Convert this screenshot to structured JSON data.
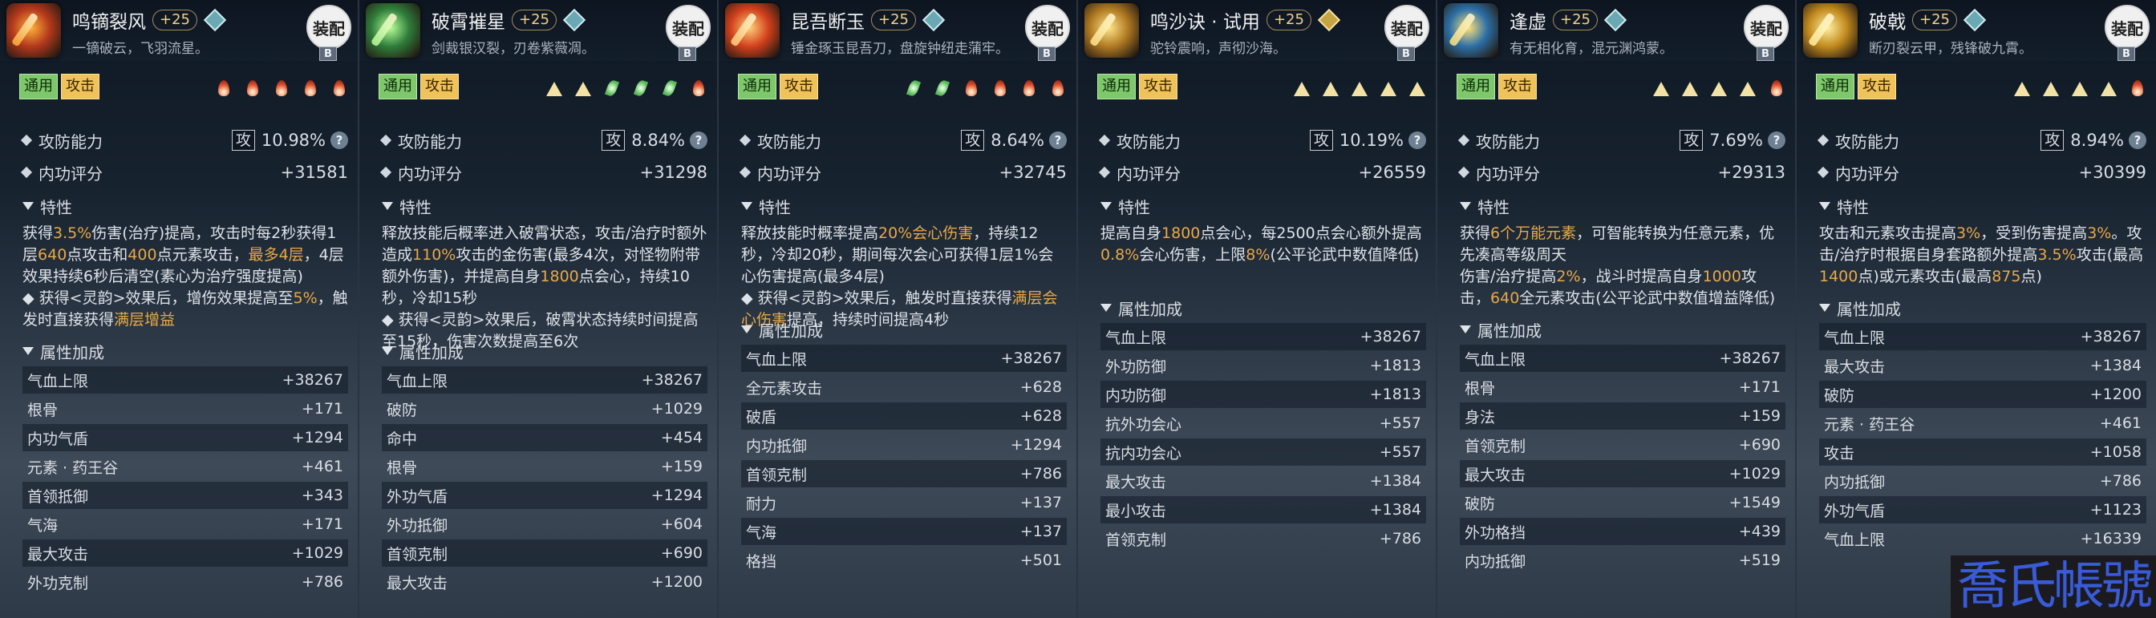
{
  "watermark": "喬氏帳號",
  "common": {
    "equip_label": "装配",
    "badge": "B",
    "tag_general": "通用",
    "tag_attack": "攻击",
    "ability_label": "攻防能力",
    "ability_box": "攻",
    "score_label": "内功评分",
    "traits_label": "特性",
    "attrs_label": "属性加成",
    "help_icon": "?"
  },
  "cards": [
    {
      "name": "鸣镝裂风",
      "level": "+25",
      "gem": "teal",
      "subtitle": "一镝破云，飞羽流星。",
      "icon": "flame-arrow-icon",
      "colors": [
        "#ffb13a",
        "#b3381c"
      ],
      "slots": [
        "fire",
        "fire",
        "fire",
        "fire",
        "fire"
      ],
      "ability": "10.98%",
      "score": "+31581",
      "desc": [
        [
          "获得",
          ""
        ],
        [
          "3.5%",
          "h"
        ],
        [
          "伤害(治疗)提高，攻击时每2秒获得1层",
          ""
        ],
        [
          "640",
          "h"
        ],
        [
          "点攻击和",
          ""
        ],
        [
          "400",
          "h"
        ],
        [
          "点元素攻击，",
          ""
        ],
        [
          "最多4层",
          "h"
        ],
        [
          "，4层效果持续6秒后清空(素心为治疗强度提高)",
          ""
        ],
        [
          "\n◆ 获得<灵韵>效果后，增伤效果提高至",
          ""
        ],
        [
          "5%",
          "h"
        ],
        [
          "，触发时直接获得",
          ""
        ],
        [
          "满层增益",
          "h"
        ]
      ],
      "attrs": [
        [
          "气血上限",
          "+38267"
        ],
        [
          "根骨",
          "+171"
        ],
        [
          "内功气盾",
          "+1294"
        ],
        [
          "元素 · 药王谷",
          "+461"
        ],
        [
          "首领抵御",
          "+343"
        ],
        [
          "气海",
          "+171"
        ],
        [
          "最大攻击",
          "+1029"
        ],
        [
          "外功克制",
          "+786"
        ]
      ]
    },
    {
      "name": "破霄摧星",
      "level": "+25",
      "gem": "teal",
      "subtitle": "剑裁银汉裂，刃卷紫薇凋。",
      "icon": "green-blade-icon",
      "colors": [
        "#b8ff9a",
        "#2f7d3a"
      ],
      "slots": [
        "tri",
        "tri",
        "leaf",
        "leaf",
        "leaf",
        "fire"
      ],
      "ability": "8.84%",
      "score": "+31298",
      "desc": [
        [
          "释放技能后概率进入破霄状态，攻击/治疗时额外造成",
          ""
        ],
        [
          "110%",
          "h"
        ],
        [
          "攻击的金伤害(最多4次，对怪物附带额外伤害)，并提高自身",
          ""
        ],
        [
          "1800",
          "h"
        ],
        [
          "点会心，持续10秒，冷却15秒",
          ""
        ],
        [
          "\n◆ 获得<灵韵>效果后，破霄状态持续时间提高至15秒，伤害次数提高至6次",
          ""
        ]
      ],
      "attrs": [
        [
          "气血上限",
          "+38267"
        ],
        [
          "破防",
          "+1029"
        ],
        [
          "命中",
          "+454"
        ],
        [
          "根骨",
          "+159"
        ],
        [
          "外功气盾",
          "+1294"
        ],
        [
          "外功抵御",
          "+604"
        ],
        [
          "首领克制",
          "+690"
        ],
        [
          "最大攻击",
          "+1200"
        ]
      ]
    },
    {
      "name": "昆吾断玉",
      "level": "+25",
      "gem": "teal",
      "subtitle": "锤金琢玉昆吾刀，盘旋钟纽走蒲牢。",
      "icon": "fire-blade-icon",
      "colors": [
        "#ffd07a",
        "#d2401c"
      ],
      "slots": [
        "leaf",
        "leaf",
        "fire",
        "fire",
        "fire",
        "fire"
      ],
      "ability": "8.64%",
      "score": "+32745",
      "desc": [
        [
          "释放技能时概率提高",
          ""
        ],
        [
          "20%会心伤害",
          "h"
        ],
        [
          "，持续12秒，冷却20秒，期间每次会心可获得1层1%会心伤害提高(最多4层)",
          ""
        ],
        [
          "\n◆ 获得<灵韵>效果后，触发时直接获得",
          ""
        ],
        [
          "满层会心伤害",
          "h"
        ],
        [
          "提高，持续时间提高4秒",
          ""
        ]
      ],
      "attrs": [
        [
          "气血上限",
          "+38267"
        ],
        [
          "全元素攻击",
          "+628"
        ],
        [
          "破盾",
          "+628"
        ],
        [
          "内功抵御",
          "+1294"
        ],
        [
          "首领克制",
          "+786"
        ],
        [
          "耐力",
          "+137"
        ],
        [
          "气海",
          "+137"
        ],
        [
          "格挡",
          "+501"
        ]
      ]
    },
    {
      "name": "鸣沙诀 · 试用",
      "level": "+25",
      "gem": "gold",
      "subtitle": "驼铃震响，声彻沙海。",
      "icon": "sand-wing-icon",
      "colors": [
        "#ffe58a",
        "#b07a22"
      ],
      "slots": [
        "tri",
        "tri",
        "tri",
        "tri",
        "tri"
      ],
      "ability": "10.19%",
      "score": "+26559",
      "desc": [
        [
          "提高自身",
          ""
        ],
        [
          "1800",
          "h"
        ],
        [
          "点会心，每2500点会心额外提高",
          ""
        ],
        [
          "0.8%",
          "h"
        ],
        [
          "会心伤害，上限",
          ""
        ],
        [
          "8%",
          "h"
        ],
        [
          "(公平论武中数值降低)",
          ""
        ]
      ],
      "attrs": [
        [
          "气血上限",
          "+38267"
        ],
        [
          "外功防御",
          "+1813"
        ],
        [
          "内功防御",
          "+1813"
        ],
        [
          "抗外功会心",
          "+557"
        ],
        [
          "抗内功会心",
          "+557"
        ],
        [
          "最大攻击",
          "+1384"
        ],
        [
          "最小攻击",
          "+1384"
        ],
        [
          "首领克制",
          "+786"
        ]
      ]
    },
    {
      "name": "逢虚",
      "level": "+25",
      "gem": "teal",
      "subtitle": "有无相化育，混元渊鸿蒙。",
      "icon": "orb-ring-icon",
      "colors": [
        "#ffe27a",
        "#2c6fa6"
      ],
      "slots": [
        "tri",
        "tri",
        "tri",
        "tri",
        "fire"
      ],
      "ability": "7.69%",
      "score": "+29313",
      "desc": [
        [
          "获得",
          ""
        ],
        [
          "6个万能元素",
          "h"
        ],
        [
          "，可智能转换为任意元素，优先凑高等级周天\n伤害/治疗提高",
          ""
        ],
        [
          "2%",
          "h"
        ],
        [
          "，战斗时提高自身",
          ""
        ],
        [
          "1000",
          "h"
        ],
        [
          "攻击，",
          ""
        ],
        [
          "640",
          "h"
        ],
        [
          "全元素攻击(公平论武中数值增益降低)",
          ""
        ]
      ],
      "attrs": [
        [
          "气血上限",
          "+38267"
        ],
        [
          "根骨",
          "+171"
        ],
        [
          "身法",
          "+159"
        ],
        [
          "首领克制",
          "+690"
        ],
        [
          "最大攻击",
          "+1029"
        ],
        [
          "破防",
          "+1549"
        ],
        [
          "外功格挡",
          "+439"
        ],
        [
          "内功抵御",
          "+519"
        ]
      ]
    },
    {
      "name": "破戟",
      "level": "+25",
      "gem": "teal",
      "subtitle": "断刃裂云甲，残锋破九霄。",
      "icon": "golden-halberd-icon",
      "colors": [
        "#fff0a0",
        "#c28a1e"
      ],
      "slots": [
        "tri",
        "tri",
        "tri",
        "tri",
        "fire"
      ],
      "ability": "8.94%",
      "score": "+30399",
      "desc": [
        [
          "攻击和元素攻击提高",
          ""
        ],
        [
          "3%",
          "h"
        ],
        [
          "，受到伤害提高",
          ""
        ],
        [
          "3%",
          "h"
        ],
        [
          "。攻击/治疗时根据自身套路额外提高",
          ""
        ],
        [
          "3.5%",
          "h"
        ],
        [
          "攻击(最高",
          ""
        ],
        [
          "1400",
          "h"
        ],
        [
          "点)或元素攻击(最高",
          ""
        ],
        [
          "875",
          "h"
        ],
        [
          "点)",
          ""
        ]
      ],
      "attrs": [
        [
          "气血上限",
          "+38267"
        ],
        [
          "最大攻击",
          "+1384"
        ],
        [
          "破防",
          "+1200"
        ],
        [
          "元素 · 药王谷",
          "+461"
        ],
        [
          "攻击",
          "+1058"
        ],
        [
          "内功抵御",
          "+786"
        ],
        [
          "外功气盾",
          "+1123"
        ],
        [
          "气血上限",
          "+16339"
        ]
      ]
    }
  ]
}
